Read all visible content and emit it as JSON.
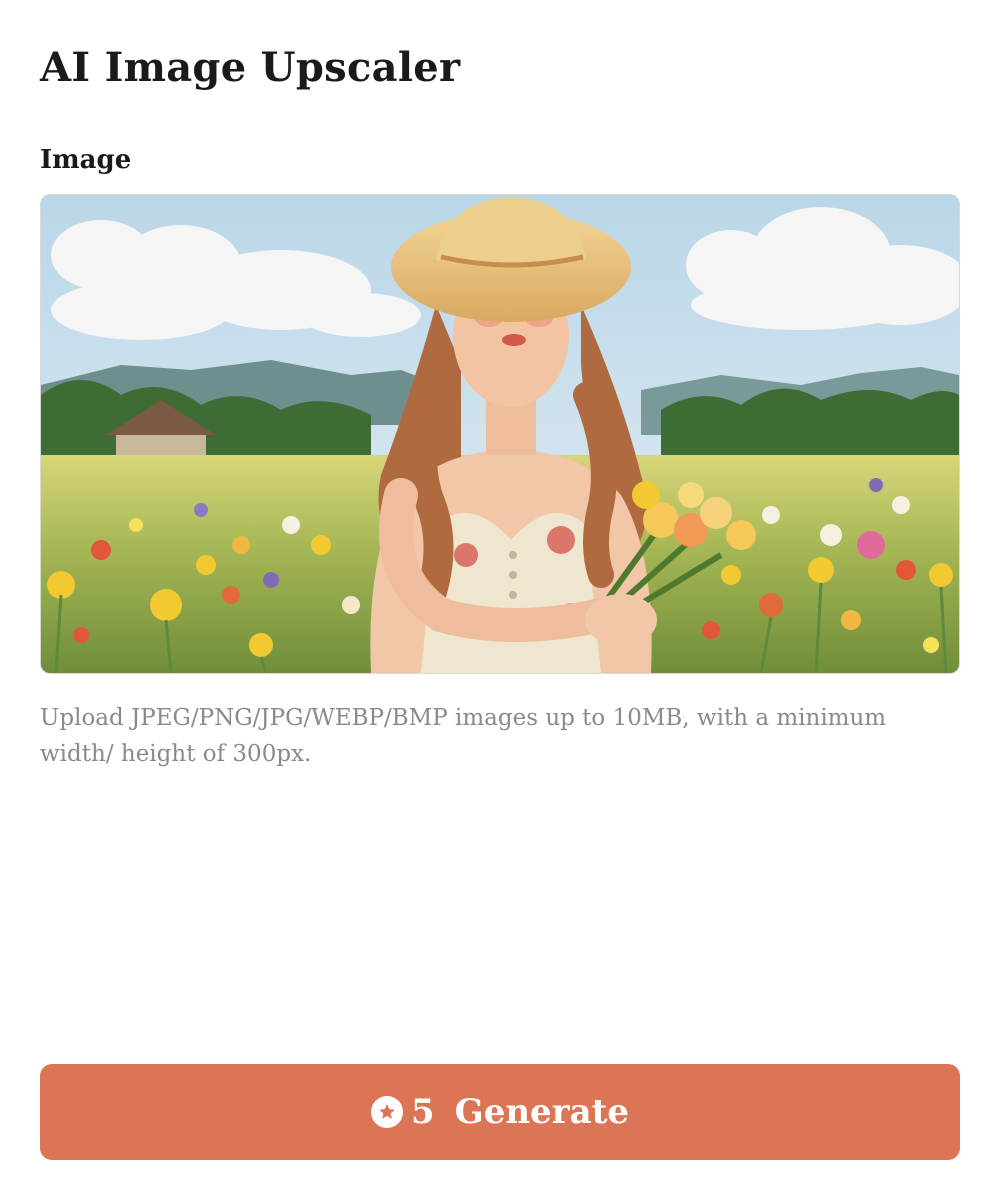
{
  "page": {
    "title": "AI Image Upscaler"
  },
  "image_field": {
    "label": "Image",
    "hint": "Upload JPEG/PNG/JPG/WEBP/BMP images up to 10MB, with a minimum width/ height of 300px."
  },
  "generate_button": {
    "credits": "5",
    "label": "Generate",
    "icon": "star-circle-icon"
  },
  "colors": {
    "accent": "#dc7556",
    "hint_text": "#8a8a8a",
    "title_text": "#1a1a1a"
  }
}
